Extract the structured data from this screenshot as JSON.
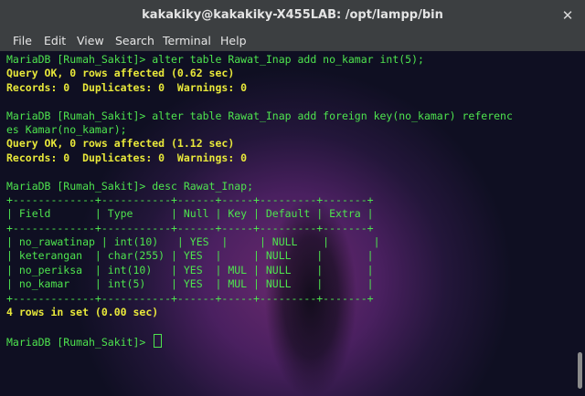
{
  "window": {
    "title": "kakakiky@kakakiky-X455LAB: /opt/lampp/bin",
    "close_glyph": "✕"
  },
  "menu": [
    "File",
    "Edit",
    "View",
    "Search",
    "Terminal",
    "Help"
  ],
  "terminal": {
    "lines": [
      {
        "text": "MariaDB [Rumah_Sakit]> alter table Rawat_Inap add no_kamar int(5);",
        "style": "green"
      },
      {
        "text": "Query OK, 0 rows affected (0.62 sec)",
        "style": "yellow"
      },
      {
        "text": "Records: 0  Duplicates: 0  Warnings: 0",
        "style": "yellow"
      },
      {
        "text": "",
        "style": "green"
      },
      {
        "text": "MariaDB [Rumah_Sakit]> alter table Rawat_Inap add foreign key(no_kamar) referenc",
        "style": "green"
      },
      {
        "text": "es Kamar(no_kamar);",
        "style": "green"
      },
      {
        "text": "Query OK, 0 rows affected (1.12 sec)",
        "style": "yellow"
      },
      {
        "text": "Records: 0  Duplicates: 0  Warnings: 0",
        "style": "yellow"
      },
      {
        "text": "",
        "style": "green"
      },
      {
        "text": "MariaDB [Rumah_Sakit]> desc Rawat_Inap;",
        "style": "green"
      },
      {
        "text": "+-------------+-----------+------+-----+---------+-------+",
        "style": "green"
      },
      {
        "text": "| Field       | Type      | Null | Key | Default | Extra |",
        "style": "green"
      },
      {
        "text": "+-------------+-----------+------+-----+---------+-------+",
        "style": "green"
      },
      {
        "text": "| no_rawatinap | int(10)   | YES  |     | NULL    |       |",
        "style": "green"
      },
      {
        "text": "| keterangan  | char(255) | YES  |     | NULL    |       |",
        "style": "green"
      },
      {
        "text": "| no_periksa  | int(10)   | YES  | MUL | NULL    |       |",
        "style": "green"
      },
      {
        "text": "| no_kamar    | int(5)    | YES  | MUL | NULL    |       |",
        "style": "green"
      },
      {
        "text": "+-------------+-----------+------+-----+---------+-------+",
        "style": "green"
      },
      {
        "text": "4 rows in set (0.00 sec)",
        "style": "yellow"
      },
      {
        "text": "",
        "style": "green"
      },
      {
        "text": "MariaDB [Rumah_Sakit]> ",
        "style": "green",
        "cursor": true
      }
    ]
  },
  "colors": {
    "prompt_green": "#4ee44e",
    "result_yellow": "#e8e83a",
    "chrome": "#3c3f41"
  }
}
